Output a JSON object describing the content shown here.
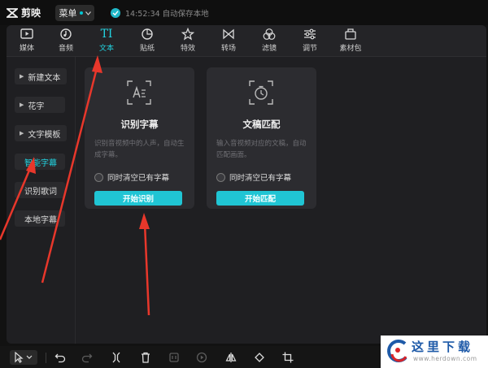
{
  "app": {
    "name": "剪映"
  },
  "topbar": {
    "menu_label": "菜单",
    "save_status": "14:52:34 自动保存本地"
  },
  "toolbar": {
    "items": [
      {
        "label": "媒体",
        "icon": "media-icon"
      },
      {
        "label": "音频",
        "icon": "audio-icon"
      },
      {
        "label": "文本",
        "icon": "text-icon",
        "active": true
      },
      {
        "label": "贴纸",
        "icon": "sticker-icon"
      },
      {
        "label": "特效",
        "icon": "effects-icon"
      },
      {
        "label": "转场",
        "icon": "transition-icon"
      },
      {
        "label": "滤镜",
        "icon": "filter-icon"
      },
      {
        "label": "调节",
        "icon": "adjust-icon"
      },
      {
        "label": "素材包",
        "icon": "material-pack-icon"
      }
    ]
  },
  "sidebar": {
    "items": [
      {
        "label": "新建文本",
        "expandable": true
      },
      {
        "label": "花字",
        "expandable": true
      },
      {
        "label": "文字模板",
        "expandable": true
      },
      {
        "label": "智能字幕",
        "active": true
      },
      {
        "label": "识别歌词"
      },
      {
        "label": "本地字幕"
      }
    ]
  },
  "cards": [
    {
      "title": "识别字幕",
      "description": "识别音视频中的人声，自动生成字幕。",
      "option_label": "同时清空已有字幕",
      "button_label": "开始识别",
      "icon": "recognize-subtitle-icon"
    },
    {
      "title": "文稿匹配",
      "description": "输入音视频对应的文稿，自动匹配画面。",
      "option_label": "同时清空已有字幕",
      "button_label": "开始匹配",
      "icon": "timer-match-icon"
    }
  ],
  "bottombar": {
    "tools": [
      "select-icon",
      "undo-icon",
      "redo-icon",
      "split-icon",
      "delete-icon",
      "freeze-icon",
      "play-icon",
      "mirror-icon",
      "rotate-icon",
      "crop-icon"
    ]
  },
  "watermark": {
    "text": "这里下载",
    "url": "www.herdown.com"
  },
  "colors": {
    "accent": "#20c5d4",
    "annotation": "#e8372b"
  }
}
